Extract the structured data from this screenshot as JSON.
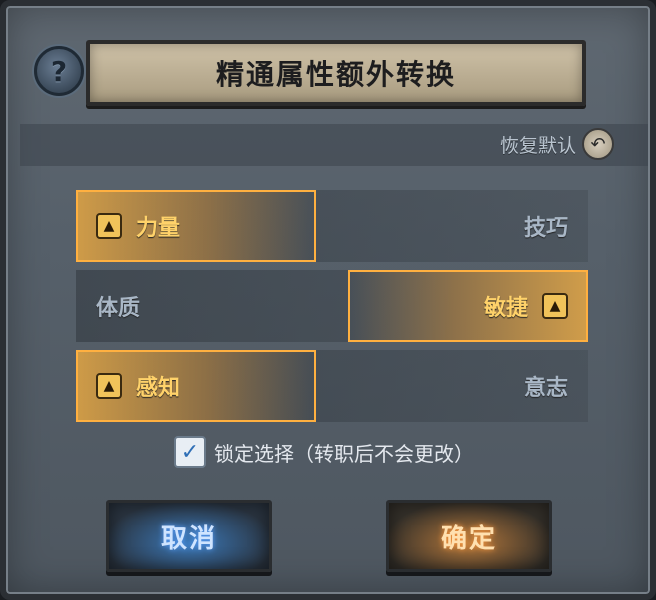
{
  "help_label": "?",
  "title": "精通属性额外转换",
  "reset": {
    "label": "恢复默认",
    "icon": "undo-icon"
  },
  "rows": [
    {
      "left": {
        "label": "力量",
        "selected": true
      },
      "right": {
        "label": "技巧",
        "selected": false
      }
    },
    {
      "left": {
        "label": "体质",
        "selected": false
      },
      "right": {
        "label": "敏捷",
        "selected": true
      }
    },
    {
      "left": {
        "label": "感知",
        "selected": true
      },
      "right": {
        "label": "意志",
        "selected": false
      }
    }
  ],
  "lock": {
    "checked": true,
    "label": "锁定选择（转职后不会更改）"
  },
  "buttons": {
    "cancel": "取消",
    "confirm": "确定"
  },
  "colors": {
    "accent": "#ffb040",
    "cancel": "#3b78b8",
    "confirm": "#b2763a"
  }
}
